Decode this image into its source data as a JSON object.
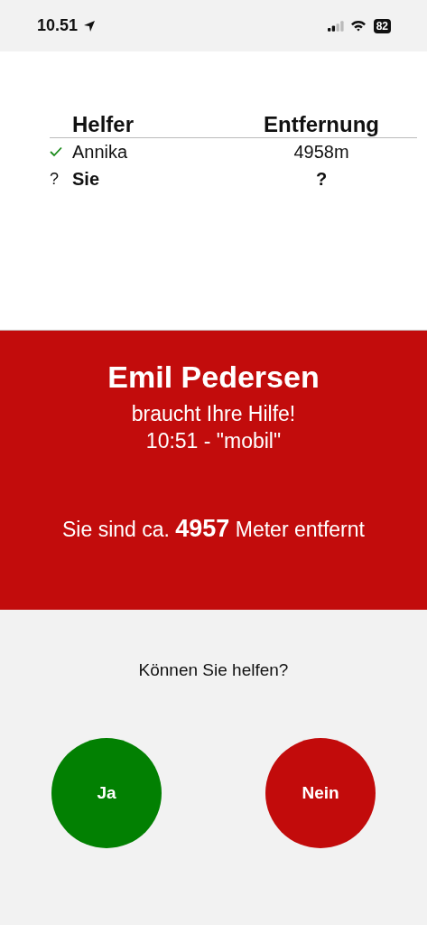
{
  "status_bar": {
    "time": "10.51",
    "battery": "82"
  },
  "helpers_table": {
    "columns": [
      "Helfer",
      "Entfernung"
    ],
    "rows": [
      {
        "kind": "confirmed",
        "name": "Annika",
        "distance": "4958m",
        "bold": false
      },
      {
        "kind": "unknown",
        "marker": "?",
        "name": "Sie",
        "distance": "?",
        "bold": true
      }
    ]
  },
  "alert": {
    "name": "Emil Pedersen",
    "message": "braucht Ihre Hilfe!",
    "time_source": "10:51 - \"mobil\"",
    "distance_text": "Sie sind ca. **4957** Meter entfernt"
  },
  "prompt": {
    "question": "Können Sie helfen?",
    "buttons": [
      {
        "kind": "yes",
        "label": "Ja"
      },
      {
        "kind": "no",
        "label": "Nein"
      }
    ]
  }
}
